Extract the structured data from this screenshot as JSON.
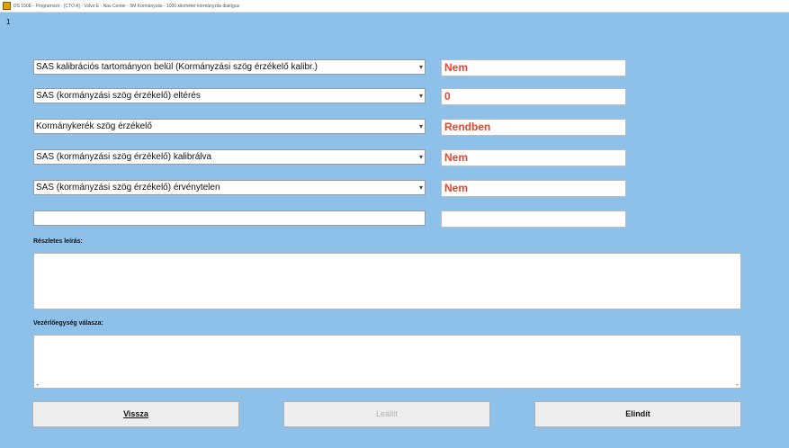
{
  "window": {
    "title": "DS 150E - Programozó - [CTO A] - Volvo E - Nav Center - 5M Kormányzás - 1000 kilométer kormányzás dialógus"
  },
  "corner_mark": "1",
  "rows": [
    {
      "label": "SAS kalibrációs tartományon belül (Kormányzási szög érzékelő kalibr.)",
      "value": "Nem"
    },
    {
      "label": "SAS (kormányzási szög érzékelő) eltérés",
      "value": "0"
    },
    {
      "label": "Kormánykerék szög érzékelő",
      "value": "Rendben"
    },
    {
      "label": "SAS (kormányzási szög érzékelő) kalibrálva",
      "value": "Nem"
    },
    {
      "label": "SAS (kormányzási szög érzékelő) érvénytelen",
      "value": "Nem"
    },
    {
      "label": "",
      "value": ""
    }
  ],
  "details": {
    "label": "Részletes leírás:"
  },
  "ecu_response": {
    "label": "Vezérlőegység válasza:"
  },
  "buttons": {
    "back": "Vissza",
    "stop": "Leállít",
    "start": "Elindít"
  },
  "colors": {
    "background": "#8ec1e9",
    "value_text": "#e8442e"
  }
}
